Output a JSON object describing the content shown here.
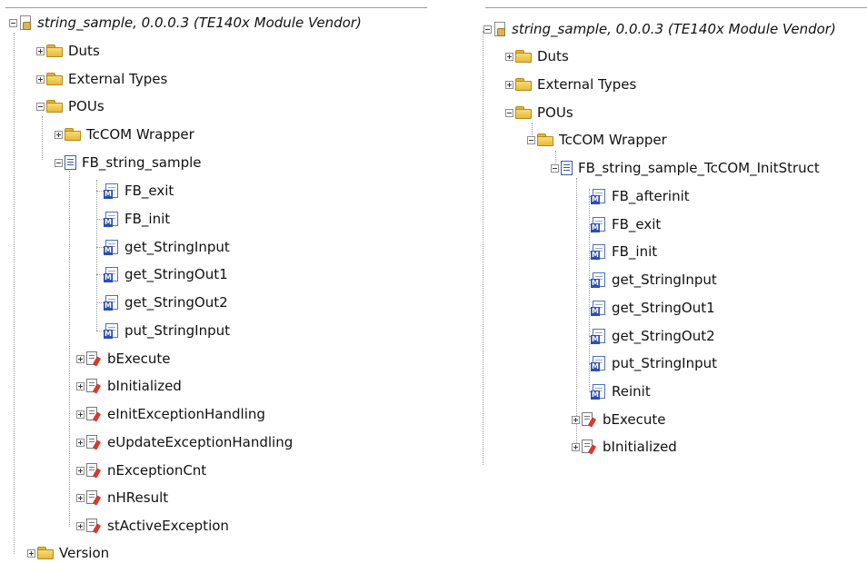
{
  "left_tree": {
    "root_label": "string_sample, 0.0.0.3 (TE140x Module Vendor)",
    "items": [
      {
        "label": "Duts"
      },
      {
        "label": "External Types"
      },
      {
        "label": "POUs"
      },
      {
        "label": "TcCOM Wrapper"
      },
      {
        "label": "FB_string_sample"
      },
      {
        "label": "FB_exit"
      },
      {
        "label": "FB_init"
      },
      {
        "label": "get_StringInput"
      },
      {
        "label": "get_StringOut1"
      },
      {
        "label": "get_StringOut2"
      },
      {
        "label": "put_StringInput"
      },
      {
        "label": "bExecute"
      },
      {
        "label": "bInitialized"
      },
      {
        "label": "eInitExceptionHandling"
      },
      {
        "label": "eUpdateExceptionHandling"
      },
      {
        "label": "nExceptionCnt"
      },
      {
        "label": "nHResult"
      },
      {
        "label": "stActiveException"
      },
      {
        "label": "Version"
      }
    ]
  },
  "right_tree": {
    "root_label": "string_sample, 0.0.0.3 (TE140x Module Vendor)",
    "items": [
      {
        "label": "Duts"
      },
      {
        "label": "External Types"
      },
      {
        "label": "POUs"
      },
      {
        "label": "TcCOM Wrapper"
      },
      {
        "label": "FB_string_sample_TcCOM_InitStruct"
      },
      {
        "label": "FB_afterinit"
      },
      {
        "label": "FB_exit"
      },
      {
        "label": "FB_init"
      },
      {
        "label": "get_StringInput"
      },
      {
        "label": "get_StringOut1"
      },
      {
        "label": "get_StringOut2"
      },
      {
        "label": "put_StringInput"
      },
      {
        "label": "Reinit"
      },
      {
        "label": "bExecute"
      },
      {
        "label": "bInitialized"
      }
    ]
  },
  "icons": {
    "project": "project-file-icon",
    "folder": "folder-icon",
    "pou": "function-block-icon",
    "method": "method-icon",
    "property": "property-icon"
  },
  "colors": {
    "folder": "#e7b93b",
    "method_badge": "#2b4fb2",
    "property_pen": "#d63a2f",
    "tree_lines": "#9a9a9a"
  }
}
